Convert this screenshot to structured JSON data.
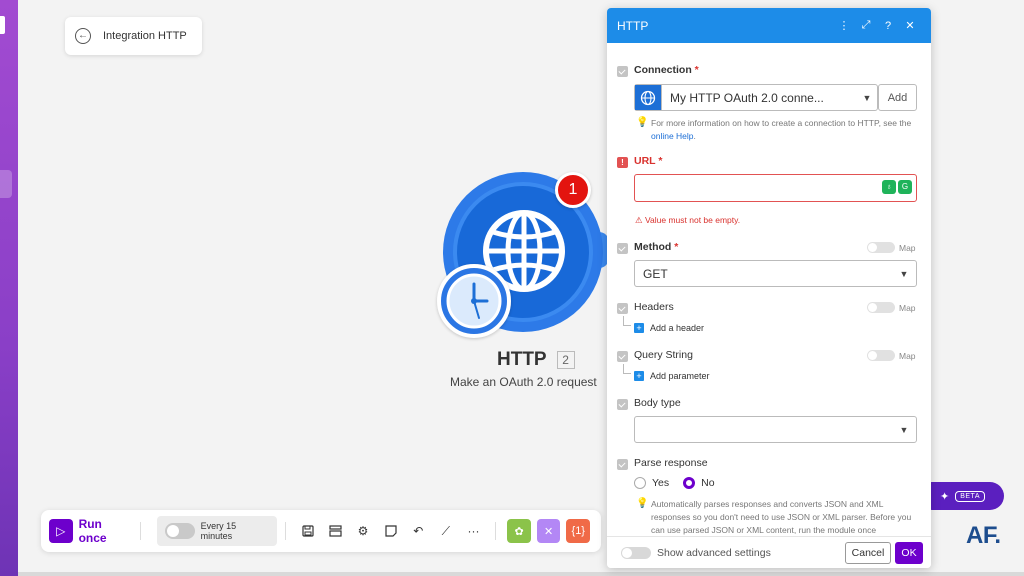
{
  "canvas": {
    "scenario_title": "Integration HTTP",
    "module": {
      "title": "HTTP",
      "number": "2",
      "subtitle": "Make an OAuth 2.0 request",
      "error_count": "1"
    }
  },
  "toolbar": {
    "run_label": "Run once",
    "schedule_label": "Every 15 minutes",
    "colors": {
      "green": "#8bc34a",
      "purple": "#b387f5",
      "orange": "#f06a47"
    }
  },
  "ai": {
    "beta_label": "BETA"
  },
  "watermark": "AF.",
  "panel": {
    "title": "HTTP",
    "connection": {
      "label": "Connection",
      "required_mark": "*",
      "selected": "My HTTP OAuth 2.0 conne...",
      "add_label": "Add",
      "hint_pre": "For more information on how to create a connection to HTTP, see the",
      "hint_link": "online Help",
      "hint_post": "."
    },
    "url": {
      "label": "URL",
      "required_mark": "*",
      "value": "",
      "error": "Value must not be empty."
    },
    "method": {
      "label": "Method",
      "required_mark": "*",
      "value": "GET",
      "map_label": "Map"
    },
    "headers": {
      "label": "Headers",
      "map_label": "Map",
      "add_label": "Add a header"
    },
    "query": {
      "label": "Query String",
      "map_label": "Map",
      "add_label": "Add parameter"
    },
    "body_type": {
      "label": "Body type",
      "value": ""
    },
    "parse": {
      "label": "Parse response",
      "yes": "Yes",
      "no": "No",
      "selected": "No",
      "hint": "Automatically parses responses and converts JSON and XML responses so you don't need to use JSON or XML parser. Before you can use parsed JSON or XML content, run the module once"
    },
    "footer": {
      "advanced_label": "Show advanced settings",
      "cancel_label": "Cancel",
      "ok_label": "OK"
    }
  },
  "accent_color": "#6d00cc",
  "header_color": "#1d8ce8",
  "error_color": "#d9322e"
}
